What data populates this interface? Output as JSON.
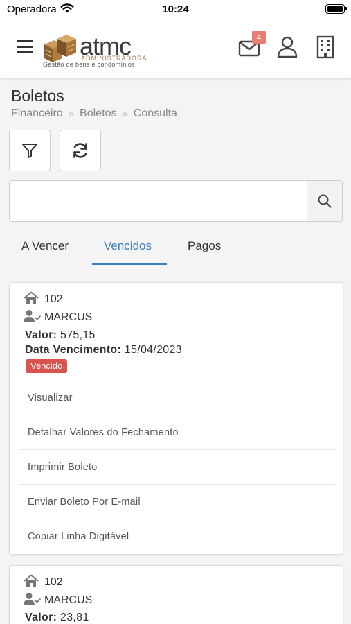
{
  "status_bar": {
    "carrier": "Operadora",
    "time": "10:24"
  },
  "header": {
    "logo": {
      "name": "atmc",
      "line1": "ADMINISTRADORA",
      "line2": "Gestão de bens e condomínios"
    },
    "mail_count": "4"
  },
  "page": {
    "title": "Boletos",
    "breadcrumb": [
      "Financeiro",
      "Boletos",
      "Consulta"
    ]
  },
  "search": {
    "value": "",
    "placeholder": ""
  },
  "tabs": [
    {
      "label": "A Vencer"
    },
    {
      "label": "Vencidos",
      "active": true
    },
    {
      "label": "Pagos"
    }
  ],
  "labels": {
    "valor": "Valor:",
    "data_vencimento": "Data Vencimento:"
  },
  "cards": [
    {
      "unit": "102",
      "owner": "MARCUS",
      "valor": "575,15",
      "vencimento": "15/04/2023",
      "status": "Vencido",
      "actions": [
        "Visualizar",
        "Detalhar Valores do Fechamento",
        "Imprimir Boleto",
        "Enviar Boleto Por E-mail",
        "Copiar Linha Digitável"
      ]
    },
    {
      "unit": "102",
      "owner": "MARCUS",
      "valor": "23,81"
    }
  ],
  "colors": {
    "accent": "#3b7dbd",
    "status_overdue": "#d9534f",
    "badge": "#e97c73"
  }
}
